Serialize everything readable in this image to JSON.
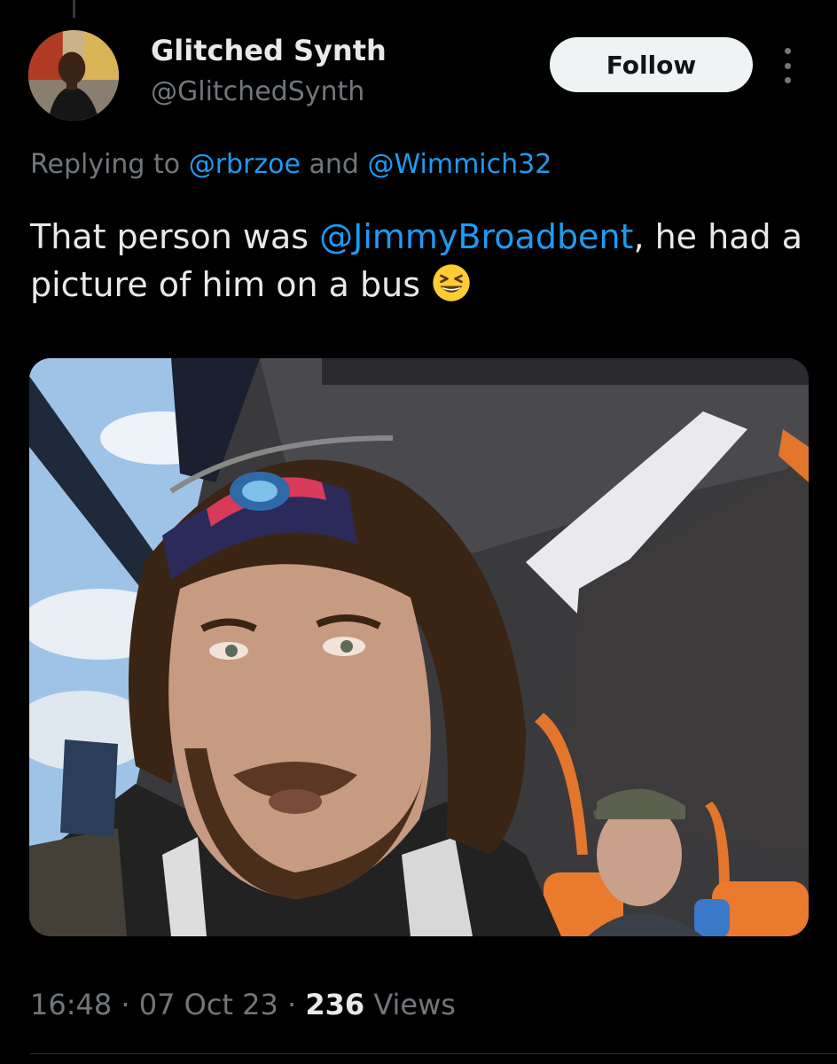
{
  "author": {
    "display_name": "Glitched Synth",
    "handle": "@GlitchedSynth",
    "avatar_icon": "profile-photo"
  },
  "follow_label": "Follow",
  "more_icon": "more-options-icon",
  "reply": {
    "prefix": "Replying to",
    "mention_1": "@rbrzoe",
    "conjunction": "and",
    "mention_2": "@Wimmich32"
  },
  "tweet": {
    "text_before": "That person was ",
    "mention": "@JimmyBroadbent",
    "text_after": ", he had a picture of him on a bus ",
    "emoji": "grinning-squinting-face-emoji"
  },
  "meta": {
    "time": "16:48",
    "separator": " · ",
    "date": "07 Oct 23",
    "views_count": "236",
    "views_label": "Views"
  },
  "colors": {
    "background": "#000000",
    "text": "#e7e9ea",
    "secondary": "#71767b",
    "accent": "#1d9bf0"
  }
}
